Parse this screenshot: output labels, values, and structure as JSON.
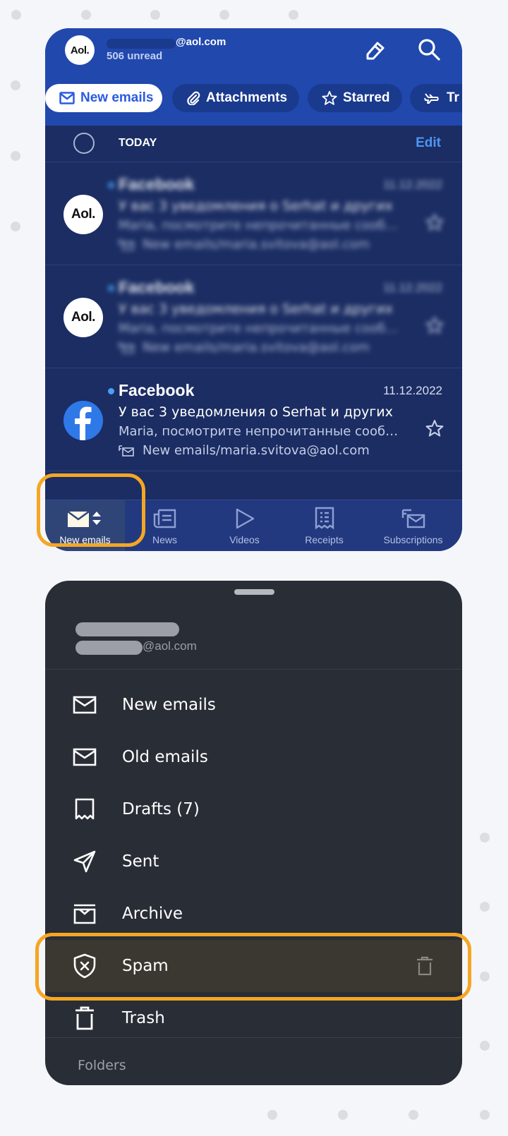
{
  "header": {
    "avatar_text": "Aol.",
    "email_domain": "@aol.com",
    "unread_count": "506 unread",
    "compose_icon": "pencil-icon",
    "search_icon": "search-icon"
  },
  "chips": [
    {
      "label": "New emails",
      "icon": "envelope-icon",
      "active": true
    },
    {
      "label": "Attachments",
      "icon": "paperclip-icon",
      "active": false
    },
    {
      "label": "Starred",
      "icon": "star-icon",
      "active": false
    },
    {
      "label": "Tr",
      "icon": "plane-icon",
      "active": false
    }
  ],
  "list": {
    "section_label": "TODAY",
    "edit_label": "Edit",
    "emails": [
      {
        "sender": "Facebook",
        "date": "11.12.2022",
        "subject": "У вас 3 уведомления о Serhat и других",
        "snippet": "Maria, посмотрите непрочитанные сообщ…",
        "folder": "New emails/maria.svitova@aol.com",
        "avatar": "Aol.",
        "unread": true,
        "blurred": true
      },
      {
        "sender": "Facebook",
        "date": "11.12.2022",
        "subject": "У вас 3 уведомления о Serhat и других",
        "snippet": "Maria, посмотрите непрочитанные сообщ…",
        "folder": "New emails/maria.svitova@aol.com",
        "avatar": "Aol.",
        "unread": true,
        "blurred": true
      },
      {
        "sender": "Facebook",
        "date": "11.12.2022",
        "subject": "У вас 3 уведомления о Serhat и других",
        "snippet": "Maria, посмотрите непрочитанные сообщ…",
        "folder": "New emails/maria.svitova@aol.com",
        "avatar": "facebook-logo",
        "unread": true,
        "blurred": false
      }
    ]
  },
  "bottom_nav": [
    {
      "label": "New emails",
      "icon": "envelope-sort-icon",
      "active": true
    },
    {
      "label": "News",
      "icon": "newspaper-icon",
      "active": false
    },
    {
      "label": "Videos",
      "icon": "play-icon",
      "active": false
    },
    {
      "label": "Receipts",
      "icon": "receipt-icon",
      "active": false
    },
    {
      "label": "Subscriptions",
      "icon": "subscriptions-icon",
      "active": false
    }
  ],
  "drawer": {
    "account_domain": "@aol.com",
    "items": [
      {
        "label": "New emails",
        "icon": "envelope-icon"
      },
      {
        "label": "Old emails",
        "icon": "envelope-icon"
      },
      {
        "label": "Drafts (7)",
        "icon": "drafts-icon"
      },
      {
        "label": "Sent",
        "icon": "send-icon"
      },
      {
        "label": "Archive",
        "icon": "archive-icon"
      },
      {
        "label": "Spam",
        "icon": "shield-x-icon",
        "selected": true,
        "action_icon": "trash-icon"
      },
      {
        "label": "Trash",
        "icon": "trash-icon"
      }
    ],
    "folders_label": "Folders"
  },
  "colors": {
    "header_blue": "#2148ad",
    "list_bg": "#1b2d63",
    "accent_link": "#4d97f0",
    "highlight": "#f5a623",
    "drawer_bg": "#292d36",
    "drawer_selected": "#3b3831"
  }
}
